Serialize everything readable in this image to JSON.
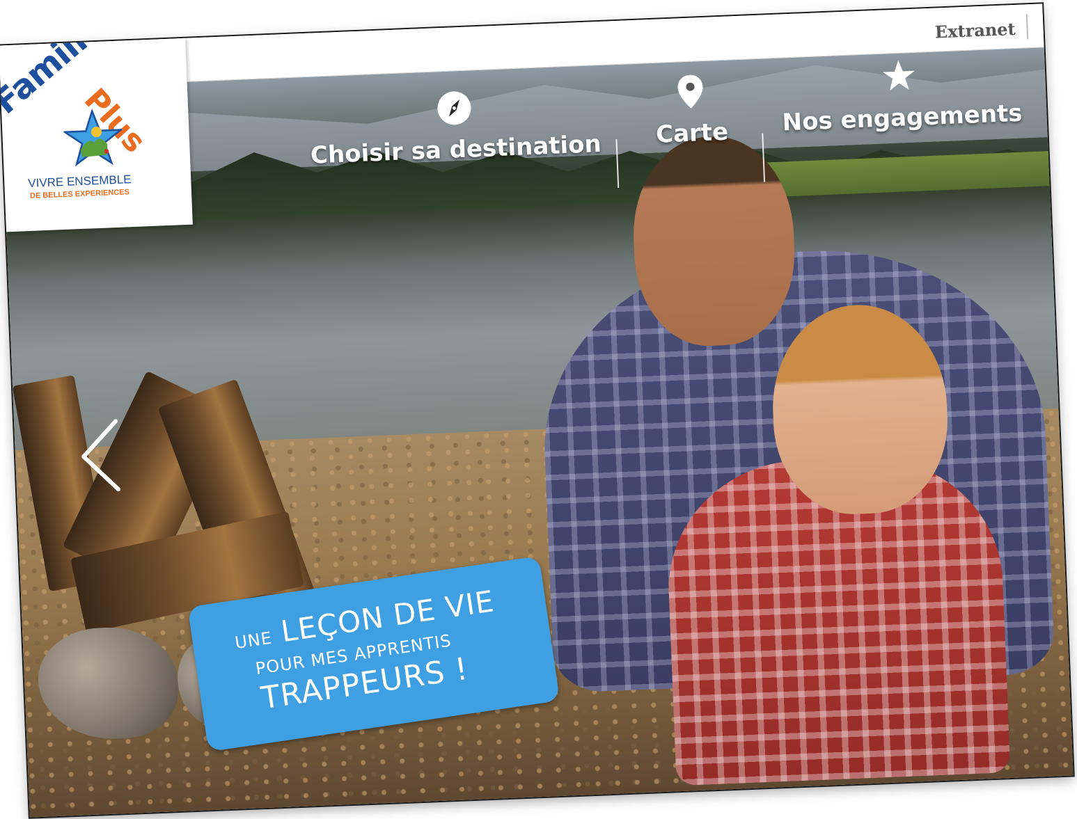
{
  "topbar": {
    "extranet_label": "Extranet"
  },
  "logo": {
    "brand_word1": "Famille",
    "brand_word2": "Plus",
    "tagline_line1": "VIVRE ENSEMBLE",
    "tagline_line2": "DE BELLES EXPERIENCES",
    "colors": {
      "blue": "#1d4f9e",
      "orange": "#ea6d1f",
      "star": "#3f9fe3"
    }
  },
  "nav": {
    "items": [
      {
        "label": "Choisir sa destination",
        "icon": "compass-icon"
      },
      {
        "label": "Carte",
        "icon": "map-pin-icon"
      },
      {
        "label": "Nos engagements",
        "icon": "star-icon"
      }
    ]
  },
  "slider": {
    "prev_icon": "chevron-left-icon",
    "caption": {
      "line1_small": "UNE",
      "line1_large": "LEÇON DE VIE",
      "line2": "POUR MES APPRENTIS",
      "line3": "TRAPPEURS !",
      "background": "#3f9fe3"
    }
  }
}
